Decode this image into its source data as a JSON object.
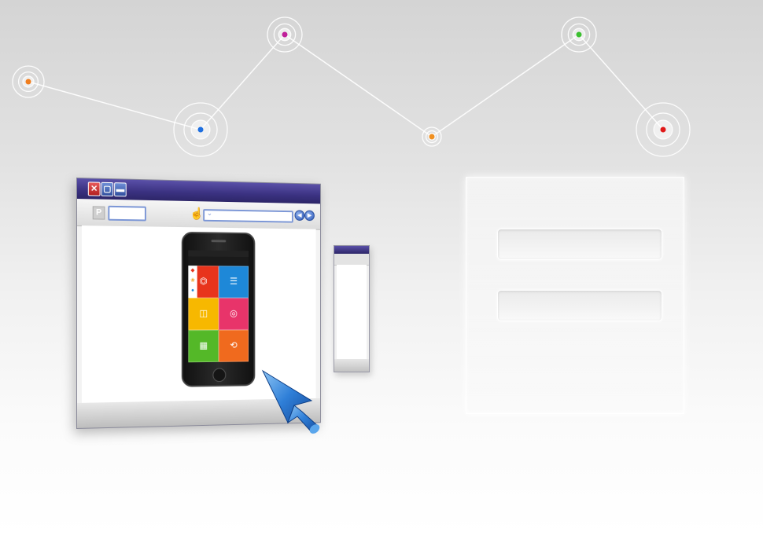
{
  "network": {
    "line_color": "#ffffff",
    "nodes": [
      {
        "name": "orange",
        "color": "#f07e1e"
      },
      {
        "name": "blue",
        "color": "#1e6fe0"
      },
      {
        "name": "magenta",
        "color": "#c0209a"
      },
      {
        "name": "orange",
        "color": "#f09020"
      },
      {
        "name": "green",
        "color": "#3cc030"
      },
      {
        "name": "red",
        "color": "#e01818"
      }
    ]
  },
  "browser": {
    "titlebar_color": "#3a3180",
    "window_buttons": {
      "close_icon": "x-icon",
      "restore_icon": "restore-icon",
      "minimize_icon": "minimize-icon"
    }
  },
  "phone": {
    "tiles": [
      {
        "color": "#e8341c",
        "icon": "pdf-icon"
      },
      {
        "color": "#1e88d8",
        "icon": "doc-icon"
      },
      {
        "color": "#f7b800",
        "icon": "image-icon"
      },
      {
        "color": "#e8346a",
        "icon": "video-icon"
      },
      {
        "color": "#54b828",
        "icon": "spreadsheet-icon"
      },
      {
        "color": "#f06a1e",
        "icon": "file-icon"
      }
    ]
  },
  "cursor": {
    "color": "#2f7fd8",
    "icon": "arrow-cursor-icon"
  },
  "login_panel": {
    "fields": [
      {
        "value": "",
        "placeholder": ""
      },
      {
        "value": "",
        "placeholder": ""
      }
    ]
  }
}
